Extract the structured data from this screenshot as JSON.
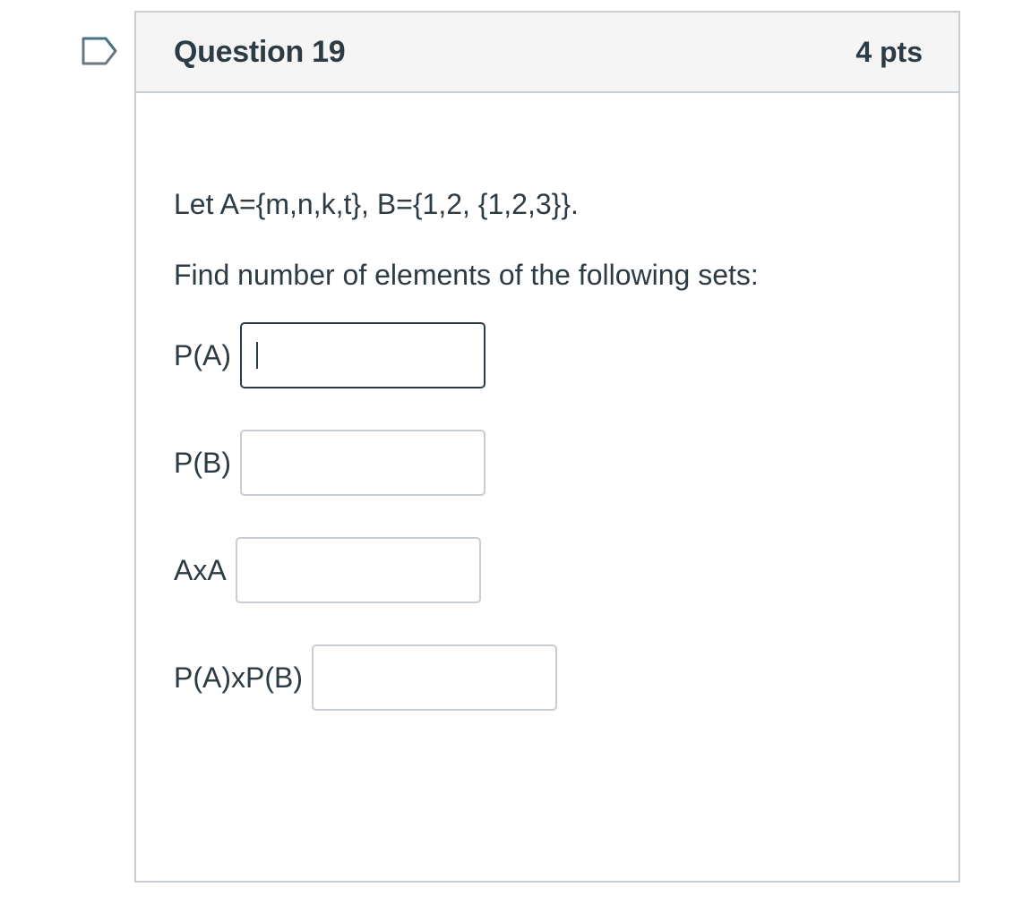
{
  "question": {
    "title": "Question 19",
    "points": "4 pts",
    "flag_icon": "flag-outline-icon",
    "prompt_line_1": "Let A={m,n,k,t}, B={1,2, {1,2,3}}.",
    "prompt_line_2": "Find number of elements of the following sets:",
    "answers": [
      {
        "label": "P(A)",
        "value": "",
        "focused": true
      },
      {
        "label": "P(B)",
        "value": ""
      },
      {
        "label": "AxA",
        "value": ""
      },
      {
        "label": "P(A)xP(B)",
        "value": ""
      }
    ]
  },
  "colors": {
    "text": "#2d3b45",
    "border": "#c7cdd1",
    "header_bg": "#f5f5f5",
    "flag_stroke": "#2d6c8c"
  }
}
